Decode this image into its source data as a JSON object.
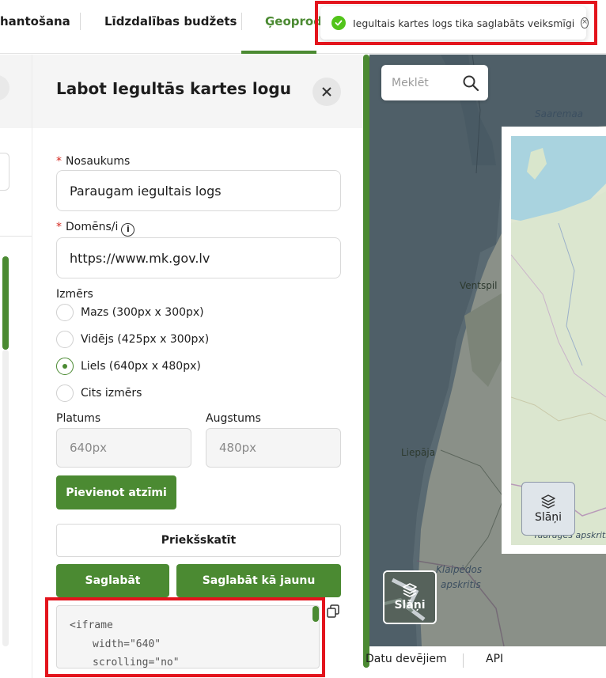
{
  "nav": {
    "items": [
      {
        "label": "hantošana"
      },
      {
        "label": "Līdzdalības budžets"
      },
      {
        "label": "Ģeoprod"
      }
    ]
  },
  "toast": {
    "message": "Iegultais kartes logs tika saglabāts veiksmīgi",
    "icon": "check-circle-icon",
    "close_icon": "close-circle-icon"
  },
  "panel": {
    "title": "Labot Iegultās kartes logu",
    "close_icon": "close-icon",
    "name_field": {
      "label": "Nosaukums",
      "required_mark": "*",
      "value": "Paraugam iegultais logs"
    },
    "domain_field": {
      "label": "Domēns/i",
      "required_mark": "*",
      "value": "https://www.mk.gov.lv",
      "info_icon": "i"
    },
    "size": {
      "label": "Izmērs",
      "options": [
        {
          "label": "Mazs (300px x 300px)",
          "checked": false
        },
        {
          "label": "Vidējs (425px x 300px)",
          "checked": false
        },
        {
          "label": "Liels (640px x 480px)",
          "checked": true
        },
        {
          "label": "Cits izmērs",
          "checked": false
        }
      ]
    },
    "width": {
      "label": "Platums",
      "value": "640px"
    },
    "height": {
      "label": "Augstums",
      "value": "480px"
    },
    "add_marker_label": "Pievienot atzīmi",
    "preview_label": "Priekšskatīt",
    "save_label": "Saglabāt",
    "save_new_label": "Saglabāt kā jaunu",
    "code_lines": [
      "<iframe",
      "width=\"640\"",
      "scrolling=\"no\""
    ],
    "copy_icon": "copy-icon"
  },
  "map": {
    "search_placeholder": "Meklēt",
    "search_icon": "search-icon",
    "layers_label": "Slāņi",
    "layers_label_2": "Slāņi",
    "places": {
      "saaremaa": "Saaremaa",
      "ventspils": "Ventspil",
      "liepaja": "Liepāja",
      "klaipeda": "Klaipėdos",
      "apskritis": "apskritis",
      "apskritis2": "Tauragės apskritis"
    }
  },
  "footer": {
    "items": [
      {
        "label": "Datu devējiem"
      },
      {
        "label": "API"
      }
    ]
  },
  "colors": {
    "primary_green": "#4b8a32",
    "highlight_red": "#e3141c",
    "success_green": "#52c41a"
  }
}
